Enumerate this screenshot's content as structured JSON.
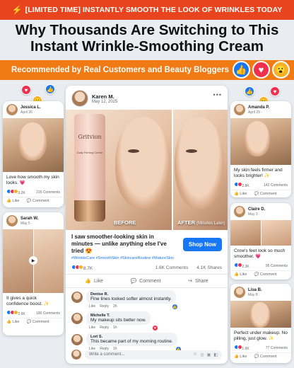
{
  "banner": {
    "text": "[LIMITED TIME] INSTANTLY SMOOTH THE LOOK OF WRINKLES TODAY"
  },
  "headline": {
    "line1": "Why Thousands Are Switching to This",
    "line2": "Instant Wrinkle-Smoothing Cream"
  },
  "recommended": {
    "text": "Recommended by Real Customers and Beauty Bloggers"
  },
  "main_post": {
    "author": "Karen M.",
    "date": "May 12, 2025",
    "product_brand": "Gritvion",
    "product_sub": "Daily Firming Creme",
    "before_label": "BEFORE",
    "after_label": "AFTER",
    "after_sub": "(Minutes Later)",
    "caption": "I saw smoother-looking skin in minutes — unlike anything else I've tried 😍",
    "hashtags": "#WrinkleCare #SmoothSkin #SkincareRoutine #MatureSkin",
    "shop_label": "Shop Now",
    "reactions": "8.7K",
    "comments_count": "1.6K Comments",
    "shares_count": "4.1K Shares",
    "like_label": "Like",
    "comment_label": "Comment",
    "share_label": "Share",
    "comments": [
      {
        "name": "Denise R.",
        "text": "Fine lines looked softer almost instantly.",
        "like": "Like",
        "reply": "Reply",
        "time": "2h"
      },
      {
        "name": "Michelle T.",
        "text": "My makeup sits better now.",
        "like": "Like",
        "reply": "Reply",
        "time": "1h"
      },
      {
        "name": "Lori S.",
        "text": "This became part of my morning routine.",
        "like": "Like",
        "reply": "Reply",
        "time": "1h"
      }
    ],
    "write_placeholder": "Write a comment..."
  },
  "side_posts": [
    {
      "name": "Jessica L.",
      "date": "April 26 ·",
      "text": "Love how smooth my skin looks. 💗",
      "reactions": "3.2K",
      "comments": "215 Comments",
      "like": "Like",
      "comment": "Comment"
    },
    {
      "name": "Sarah W.",
      "date": "May 5 ·",
      "text": "It gives a quick confidence boost. ✨",
      "reactions": "2.9K",
      "comments": "180 Comments",
      "like": "Like",
      "comment": "Comment"
    },
    {
      "name": "Amanda P.",
      "date": "April 29 ·",
      "text": "My skin feels firmer and looks brighter! ✨",
      "reactions": "2.8K",
      "comments": "142 Comments",
      "like": "Like",
      "comment": "Comment"
    },
    {
      "name": "Claire D.",
      "date": "May 3 ·",
      "text": "Crow's feet look so much smoother. 💗",
      "reactions": "2.3K",
      "comments": "95 Comments",
      "like": "Like",
      "comment": "Comment"
    },
    {
      "name": "Lisa B.",
      "date": "May 8 ·",
      "text": "Perfect under makeup. No pilling, just glow. ✨",
      "reactions": "1.9K",
      "comments": "77 Comments",
      "like": "Like",
      "comment": "Comment"
    }
  ],
  "colors": {
    "banner": "#e8451e",
    "rec_bar": "#f07a14",
    "facebook_blue": "#1877f2",
    "love": "#f0304f",
    "wow": "#f7b125"
  }
}
